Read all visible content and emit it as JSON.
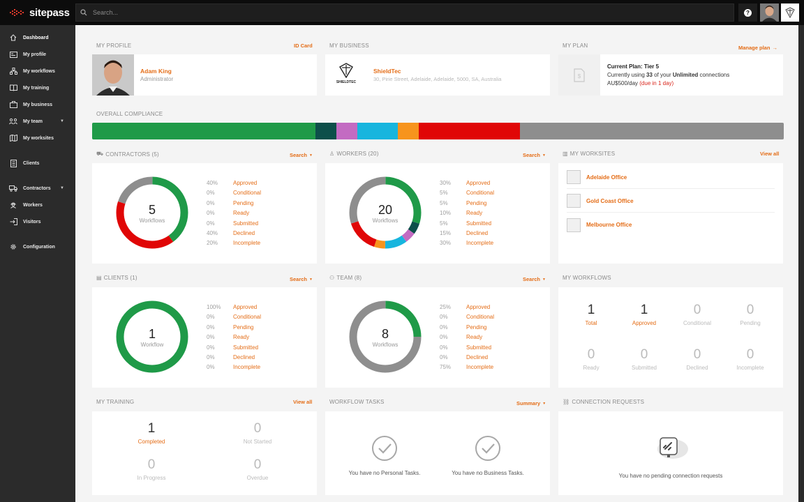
{
  "brand": {
    "name": "sitepass",
    "accent": "#e46d17"
  },
  "search": {
    "placeholder": "Search..."
  },
  "topbar": {
    "help_icon": "question-icon",
    "help_glyph": "?"
  },
  "sidebar": {
    "items": [
      {
        "label": "Dashboard",
        "icon": "home-icon"
      },
      {
        "label": "My profile",
        "icon": "id-card-icon"
      },
      {
        "label": "My workflows",
        "icon": "workflow-icon"
      },
      {
        "label": "My training",
        "icon": "book-icon"
      },
      {
        "label": "My business",
        "icon": "briefcase-icon"
      },
      {
        "label": "My team",
        "icon": "team-icon"
      },
      {
        "label": "My worksites",
        "icon": "map-icon"
      },
      {
        "label": "Clients",
        "icon": "building-icon"
      },
      {
        "label": "Contractors",
        "icon": "truck-icon"
      },
      {
        "label": "Workers",
        "icon": "worker-icon"
      },
      {
        "label": "Visitors",
        "icon": "login-icon"
      },
      {
        "label": "Configuration",
        "icon": "gear-icon"
      }
    ]
  },
  "profile": {
    "heading": "MY PROFILE",
    "link": "ID Card",
    "name": "Adam King",
    "role": "Administrator"
  },
  "business": {
    "heading": "MY BUSINESS",
    "name": "ShieldTec",
    "address": "30, Pirie Street, Adelaide, Adelaide, 5000, SA, Australia",
    "logo_text": "SHIELDTEC"
  },
  "plan": {
    "heading": "MY PLAN",
    "link": "Manage plan",
    "title": "Current Plan: Tier 5",
    "usage_pre": "Currently using ",
    "usage_count": "33",
    "usage_mid": " of your ",
    "usage_limit": "Unlimited",
    "usage_post": " connections",
    "price": "AU$500/day ",
    "due": "(due in 1 day)"
  },
  "compliance": {
    "heading": "OVERALL COMPLIANCE",
    "segments": [
      {
        "color": "#1f9a48",
        "fraction": 0.323
      },
      {
        "color": "#0d4f4a",
        "fraction": 0.03
      },
      {
        "color": "#c36bc2",
        "fraction": 0.03
      },
      {
        "color": "#17b5de",
        "fraction": 0.059
      },
      {
        "color": "#f7941d",
        "fraction": 0.03
      },
      {
        "color": "#e00606",
        "fraction": 0.147
      },
      {
        "color": "#8e8e8e",
        "fraction": 0.381
      }
    ]
  },
  "status_colors": {
    "Approved": "#1f9a48",
    "Conditional": "#0d4f4a",
    "Pending": "#c36bc2",
    "Ready": "#17b5de",
    "Submitted": "#f7941d",
    "Declined": "#e00606",
    "Incomplete": "#8e8e8e"
  },
  "contractors": {
    "heading": "CONTRACTORS (5)",
    "link": "Search",
    "count": "5",
    "caption": "Workflows",
    "legend": [
      {
        "pct": "40%",
        "label": "Approved",
        "value": 40
      },
      {
        "pct": "0%",
        "label": "Conditional",
        "value": 0
      },
      {
        "pct": "0%",
        "label": "Pending",
        "value": 0
      },
      {
        "pct": "0%",
        "label": "Ready",
        "value": 0
      },
      {
        "pct": "0%",
        "label": "Submitted",
        "value": 0
      },
      {
        "pct": "40%",
        "label": "Declined",
        "value": 40
      },
      {
        "pct": "20%",
        "label": "Incomplete",
        "value": 20
      }
    ]
  },
  "workers": {
    "heading": "WORKERS (20)",
    "link": "Search",
    "count": "20",
    "caption": "Workflows",
    "legend": [
      {
        "pct": "30%",
        "label": "Approved",
        "value": 30
      },
      {
        "pct": "5%",
        "label": "Conditional",
        "value": 5
      },
      {
        "pct": "5%",
        "label": "Pending",
        "value": 5
      },
      {
        "pct": "10%",
        "label": "Ready",
        "value": 10
      },
      {
        "pct": "5%",
        "label": "Submitted",
        "value": 5
      },
      {
        "pct": "15%",
        "label": "Declined",
        "value": 15
      },
      {
        "pct": "30%",
        "label": "Incomplete",
        "value": 30
      }
    ]
  },
  "worksites": {
    "heading": "MY WORKSITES",
    "link": "View all",
    "items": [
      {
        "name": "Adelaide Office"
      },
      {
        "name": "Gold Coast Office"
      },
      {
        "name": "Melbourne Office"
      }
    ]
  },
  "clients": {
    "heading": "CLIENTS (1)",
    "link": "Search",
    "count": "1",
    "caption": "Workflow",
    "legend": [
      {
        "pct": "100%",
        "label": "Approved",
        "value": 100
      },
      {
        "pct": "0%",
        "label": "Conditional",
        "value": 0
      },
      {
        "pct": "0%",
        "label": "Pending",
        "value": 0
      },
      {
        "pct": "0%",
        "label": "Ready",
        "value": 0
      },
      {
        "pct": "0%",
        "label": "Submitted",
        "value": 0
      },
      {
        "pct": "0%",
        "label": "Declined",
        "value": 0
      },
      {
        "pct": "0%",
        "label": "Incomplete",
        "value": 0
      }
    ]
  },
  "team": {
    "heading": "TEAM (8)",
    "link": "Search",
    "count": "8",
    "caption": "Workflows",
    "legend": [
      {
        "pct": "25%",
        "label": "Approved",
        "value": 25
      },
      {
        "pct": "0%",
        "label": "Conditional",
        "value": 0
      },
      {
        "pct": "0%",
        "label": "Pending",
        "value": 0
      },
      {
        "pct": "0%",
        "label": "Ready",
        "value": 0
      },
      {
        "pct": "0%",
        "label": "Submitted",
        "value": 0
      },
      {
        "pct": "0%",
        "label": "Declined",
        "value": 0
      },
      {
        "pct": "75%",
        "label": "Incomplete",
        "value": 75
      }
    ]
  },
  "my_workflows": {
    "heading": "MY WORKFLOWS",
    "cells": [
      {
        "n": "1",
        "label": "Total",
        "highlight": true
      },
      {
        "n": "1",
        "label": "Approved",
        "highlight": true
      },
      {
        "n": "0",
        "label": "Conditional",
        "highlight": false
      },
      {
        "n": "0",
        "label": "Pending",
        "highlight": false
      },
      {
        "n": "0",
        "label": "Ready",
        "highlight": false
      },
      {
        "n": "0",
        "label": "Submitted",
        "highlight": false
      },
      {
        "n": "0",
        "label": "Declined",
        "highlight": false
      },
      {
        "n": "0",
        "label": "Incomplete",
        "highlight": false
      }
    ]
  },
  "training": {
    "heading": "MY TRAINING",
    "link": "View all",
    "cells": [
      {
        "n": "1",
        "label": "Completed",
        "highlight": true
      },
      {
        "n": "0",
        "label": "Not Started",
        "highlight": false
      },
      {
        "n": "0",
        "label": "In Progress",
        "highlight": false
      },
      {
        "n": "0",
        "label": "Overdue",
        "highlight": false
      }
    ]
  },
  "tasks": {
    "heading": "WORKFLOW TASKS",
    "link": "Summary",
    "personal": "You have no Personal Tasks.",
    "business": "You have no Business Tasks."
  },
  "connections": {
    "heading": "CONNECTION REQUESTS",
    "message": "You have no pending connection requests"
  }
}
